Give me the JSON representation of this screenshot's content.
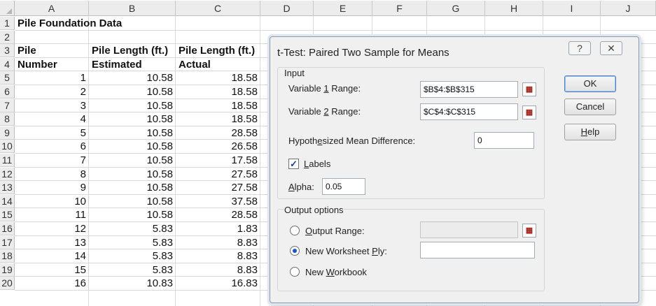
{
  "columns": [
    "A",
    "B",
    "C",
    "D",
    "E",
    "F",
    "G",
    "H",
    "I",
    "J"
  ],
  "rows": [
    "1",
    "2",
    "3",
    "4",
    "5",
    "6",
    "7",
    "8",
    "9",
    "10",
    "11",
    "12",
    "13",
    "14",
    "15",
    "16",
    "17",
    "18",
    "19",
    "20"
  ],
  "sheet": {
    "title": "Pile Foundation Data",
    "header_row3": [
      "Pile",
      "Pile Length (ft.)",
      "Pile Length (ft.)"
    ],
    "header_row4": [
      "Number",
      "Estimated",
      "Actual"
    ],
    "data": [
      [
        "1",
        "10.58",
        "18.58"
      ],
      [
        "2",
        "10.58",
        "18.58"
      ],
      [
        "3",
        "10.58",
        "18.58"
      ],
      [
        "4",
        "10.58",
        "18.58"
      ],
      [
        "5",
        "10.58",
        "28.58"
      ],
      [
        "6",
        "10.58",
        "26.58"
      ],
      [
        "7",
        "10.58",
        "17.58"
      ],
      [
        "8",
        "10.58",
        "27.58"
      ],
      [
        "9",
        "10.58",
        "27.58"
      ],
      [
        "10",
        "10.58",
        "37.58"
      ],
      [
        "11",
        "10.58",
        "28.58"
      ],
      [
        "12",
        "5.83",
        "1.83"
      ],
      [
        "13",
        "5.83",
        "8.83"
      ],
      [
        "14",
        "5.83",
        "8.83"
      ],
      [
        "15",
        "5.83",
        "8.83"
      ],
      [
        "16",
        "10.83",
        "16.83"
      ]
    ]
  },
  "dialog": {
    "title": "t-Test: Paired Two Sample for Means",
    "help_icon": "question-mark-icon",
    "close_icon": "close-icon",
    "input_group_label": "Input",
    "var1_label_pre": "Variable ",
    "var1_label_key": "1",
    "var1_label_post": " Range:",
    "var1_value": "$B$4:$B$315",
    "var2_label_pre": "Variable ",
    "var2_label_key": "2",
    "var2_label_post": " Range:",
    "var2_value": "$C$4:$C$315",
    "hmd_label_pre": "Hypoth",
    "hmd_label_key": "e",
    "hmd_label_post": "sized Mean Difference:",
    "hmd_value": "0",
    "labels_checked": true,
    "labels_label_key": "L",
    "labels_label_post": "abels",
    "alpha_label_key": "A",
    "alpha_label_post": "lpha:",
    "alpha_value": "0.05",
    "output_group_label": "Output options",
    "output_range_key": "O",
    "output_range_post": "utput Range:",
    "output_range_value": "",
    "new_ply_label_pre": "New Worksheet ",
    "new_ply_label_key": "P",
    "new_ply_label_post": "ly:",
    "new_ply_value": "",
    "new_workbook_pre": "New ",
    "new_workbook_key": "W",
    "new_workbook_post": "orkbook",
    "selected_output": "New Worksheet Ply",
    "ok_label": "OK",
    "cancel_label": "Cancel",
    "help_key": "H",
    "help_post": "elp",
    "ref_button_icon": "range-selector-icon",
    "checkmark": "✓"
  }
}
